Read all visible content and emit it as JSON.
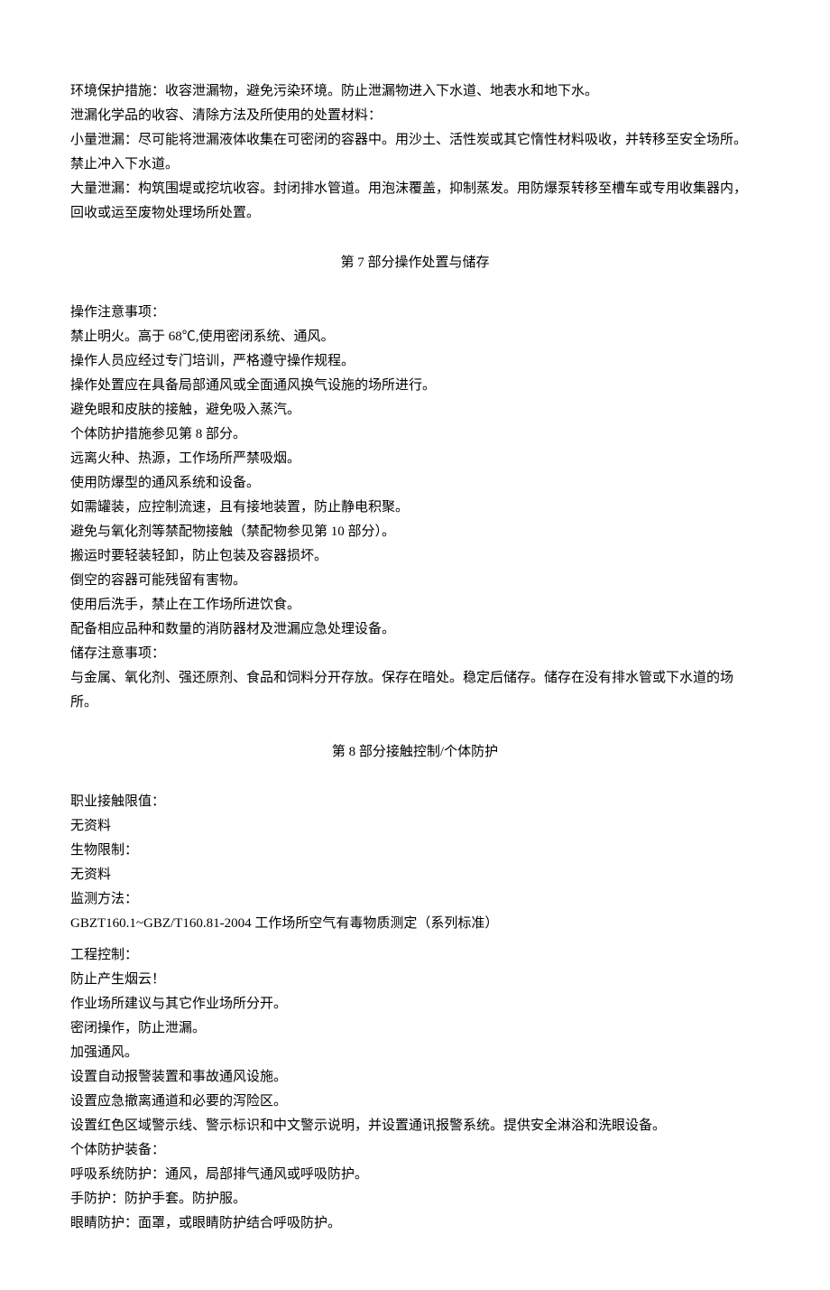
{
  "section6": {
    "p1": "环境保护措施：收容泄漏物，避免污染环境。防止泄漏物进入下水道、地表水和地下水。",
    "p2": "泄漏化学品的收容、清除方法及所使用的处置材料：",
    "p3": "小量泄漏：尽可能将泄漏液体收集在可密闭的容器中。用沙土、活性炭或其它惰性材料吸收，并转移至安全场所。禁止冲入下水道。",
    "p4": "大量泄漏：构筑围堤或挖坑收容。封闭排水管道。用泡沫覆盖，抑制蒸发。用防爆泵转移至槽车或专用收集器内，回收或运至废物处理场所处置。"
  },
  "section7": {
    "title": "第 7 部分操作处置与储存",
    "p1": "操作注意事项：",
    "p2": "禁止明火。高于 68℃,使用密闭系统、通风。",
    "p3": "操作人员应经过专门培训，严格遵守操作规程。",
    "p4": "操作处置应在具备局部通风或全面通风换气设施的场所进行。",
    "p5": "避免眼和皮肤的接触，避免吸入蒸汽。",
    "p6": "个体防护措施参见第 8 部分。",
    "p7": "远离火种、热源，工作场所严禁吸烟。",
    "p8": "使用防爆型的通风系统和设备。",
    "p9": "如需罐装，应控制流速，且有接地装置，防止静电积聚。",
    "p10": "避免与氧化剂等禁配物接触（禁配物参见第 10 部分）。",
    "p11": "搬运时要轻装轻卸，防止包装及容器损坏。",
    "p12": "倒空的容器可能残留有害物。",
    "p13": "使用后洗手，禁止在工作场所进饮食。",
    "p14": "配备相应品种和数量的消防器材及泄漏应急处理设备。",
    "p15": "储存注意事项：",
    "p16": "与金属、氧化剂、强还原剂、食品和饲料分开存放。保存在暗处。稳定后储存。储存在没有排水管或下水道的场所。"
  },
  "section8": {
    "title": "第 8 部分接触控制/个体防护",
    "p1": "职业接触限值：",
    "p2": "无资料",
    "p3": "生物限制：",
    "p4": "无资料",
    "p5": "监测方法：",
    "p6": "GBZT160.1~GBZ/T160.81-2004 工作场所空气有毒物质测定（系列标准）",
    "p7": "工程控制：",
    "p8": "防止产生烟云！",
    "p9": "作业场所建议与其它作业场所分开。",
    "p10": "密闭操作，防止泄漏。",
    "p11": "加强通风。",
    "p12": "设置自动报警装置和事故通风设施。",
    "p13": "设置应急撤离通道和必要的泻险区。",
    "p14": "设置红色区域警示线、警示标识和中文警示说明，并设置通讯报警系统。提供安全淋浴和洗眼设备。",
    "p15": "个体防护装备：",
    "p16": "呼吸系统防护：通风，局部排气通风或呼吸防护。",
    "p17": "手防护：防护手套。防护服。",
    "p18": "眼睛防护：面罩，或眼睛防护结合呼吸防护。"
  }
}
